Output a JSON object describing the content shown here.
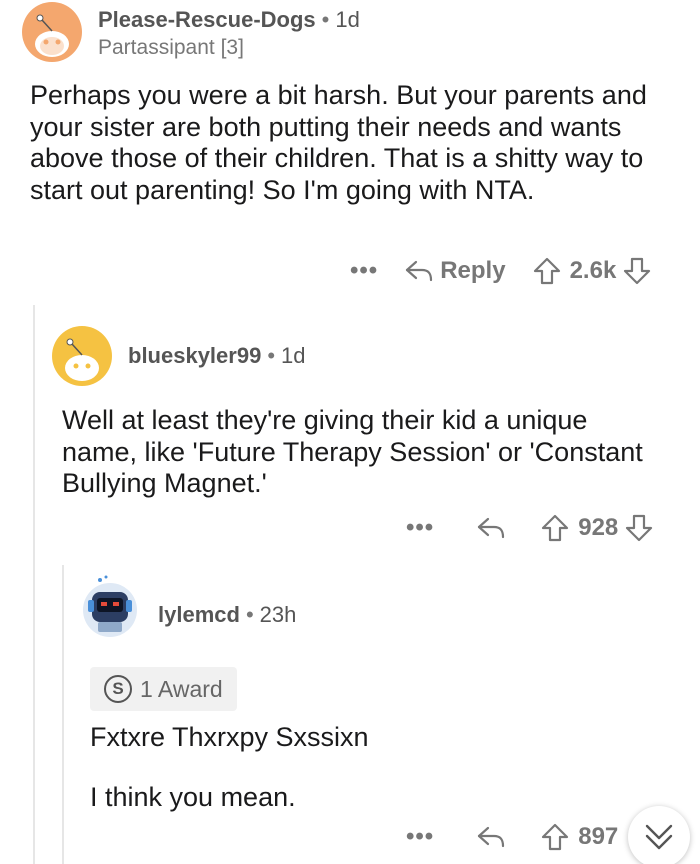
{
  "comments": [
    {
      "username": "Please-Rescue-Dogs",
      "age": "1d",
      "flair": "Partassipant [3]",
      "body": "Perhaps you were a bit harsh. But your parents and your sister are both putting their needs and wants above those of their children. That is a shitty way to start out parenting! So I'm going with NTA.",
      "more": "•••",
      "reply_label": "Reply",
      "score": "2.6k"
    },
    {
      "username": "blueskyler99",
      "age": "1d",
      "body": "Well at least they're giving their kid a unique name, like 'Future Therapy Session' or 'Constant Bullying Magnet.'",
      "more": "•••",
      "score": "928"
    },
    {
      "username": "lylemcd",
      "age": "23h",
      "award": "1 Award",
      "award_symbol": "S",
      "body_line1": "Fxtxre Thxrxpy Sxssixn",
      "body_line2": "I think you mean.",
      "more": "•••",
      "score": "897"
    }
  ],
  "colors": {
    "orange_avatar": "#f4a76e",
    "yellow_avatar": "#f5c242",
    "meta_text": "#777777",
    "body_text": "#1a1a1b"
  }
}
